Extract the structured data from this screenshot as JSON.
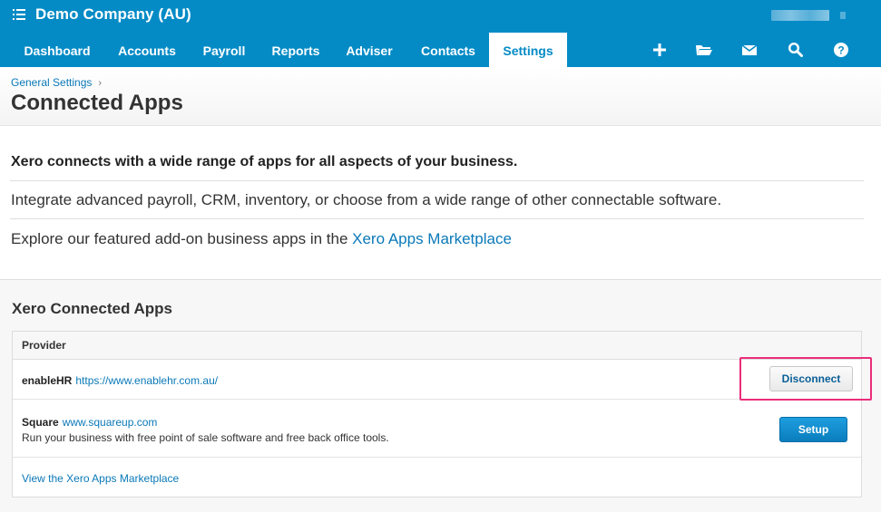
{
  "topbar": {
    "org_name": "Demo Company (AU)",
    "background_color": "#048bc6",
    "menu_icon": "list-icon"
  },
  "nav": {
    "tabs": [
      {
        "label": "Dashboard",
        "active": false
      },
      {
        "label": "Accounts",
        "active": false
      },
      {
        "label": "Payroll",
        "active": false
      },
      {
        "label": "Reports",
        "active": false
      },
      {
        "label": "Adviser",
        "active": false
      },
      {
        "label": "Contacts",
        "active": false
      },
      {
        "label": "Settings",
        "active": true
      }
    ],
    "icons": [
      "add-icon",
      "folder-icon",
      "mail-icon",
      "search-icon",
      "help-icon"
    ]
  },
  "header": {
    "breadcrumb": "General Settings",
    "title": "Connected Apps"
  },
  "intro": {
    "heading": "Xero connects with a wide range of apps for all aspects of your business.",
    "line1": "Integrate advanced payroll, CRM, inventory, or choose from a wide range of other connectable software.",
    "line2_prefix": "Explore our featured add-on business apps in the ",
    "line2_link": "Xero Apps Marketplace"
  },
  "connected": {
    "title": "Xero Connected Apps",
    "column_header": "Provider",
    "apps": [
      {
        "name": "enableHR",
        "url": "https://www.enablehr.com.au/",
        "description": "",
        "action": "Disconnect"
      },
      {
        "name": "Square",
        "url": "www.squareup.com",
        "description": "Run your business with free point of sale software and free back office tools.",
        "action": "Setup"
      }
    ],
    "footer_link": "View the Xero Apps Marketplace"
  },
  "colors": {
    "brand": "#048bc6",
    "link": "#0a79b8",
    "highlight": "#ea2d7a"
  }
}
